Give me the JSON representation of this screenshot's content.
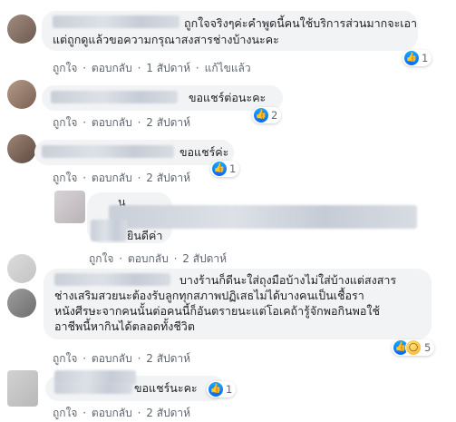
{
  "comments": [
    {
      "text_lines": [
        "ถูกใจจริงๆค่ะคำพูดนี้คนใช้บริการส่วนมากจะเอา",
        "แต่ถูกดูแล้วขอความกรุณาสงสารช่างบ้างนะคะ"
      ],
      "actions": [
        "ถูกใจ",
        "ตอบกลับ",
        "1 สัปดาห์",
        "แก้ไขแล้ว"
      ],
      "reaction_count": "1"
    },
    {
      "text_lines": [
        "ขอแชร์ต่อนะคะ"
      ],
      "actions": [
        "ถูกใจ",
        "ตอบกลับ",
        "2 สัปดาห์"
      ],
      "reaction_count": "2"
    },
    {
      "text_lines": [
        "ขอแชร์ค่ะ"
      ],
      "actions": [
        "ถูกใจ",
        "ตอบกลับ",
        "2 สัปดาห์"
      ],
      "reaction_count": "1"
    },
    {
      "name_partial": "น",
      "text_lines": [
        "ยินดีค่า"
      ],
      "actions": [
        "ถูกใจ",
        "ตอบกลับ",
        "2 สัปดาห์"
      ]
    },
    {
      "text_lines": [
        "บางร้านก็ดีนะใส่ถุงมือบ้างไม่ใส่บ้างแต่สงสาร",
        "ช่างเสริมสวยนะต้องรับลูกทุกสภาพปฏิเสธไม่ได้บางคนเป็นเชื้อรา",
        "หนังศีรษะจากคนนั้นต่อคนนี้ก็อันตรายนะแต่โอเคถ้ารู้จักพอกินพอใช้",
        "อาชีพนี้หากินได้ตลอดทั้งชีวิต"
      ],
      "actions": [
        "ถูกใจ",
        "ตอบกลับ",
        "2 สัปดาห์"
      ],
      "reaction_count": "5"
    },
    {
      "text_lines": [
        "ขอแชร์นะคะ"
      ],
      "actions": [
        "ถูกใจ",
        "ตอบกลับ",
        "2 สัปดาห์"
      ],
      "reaction_count": "1"
    }
  ],
  "separator": "·",
  "icons": {
    "like": "like-icon",
    "wow": "wow-icon"
  },
  "colors": {
    "like_blue": "#0866ff",
    "action_gray": "#606770",
    "bubble_bg": "#f2f3f5"
  }
}
